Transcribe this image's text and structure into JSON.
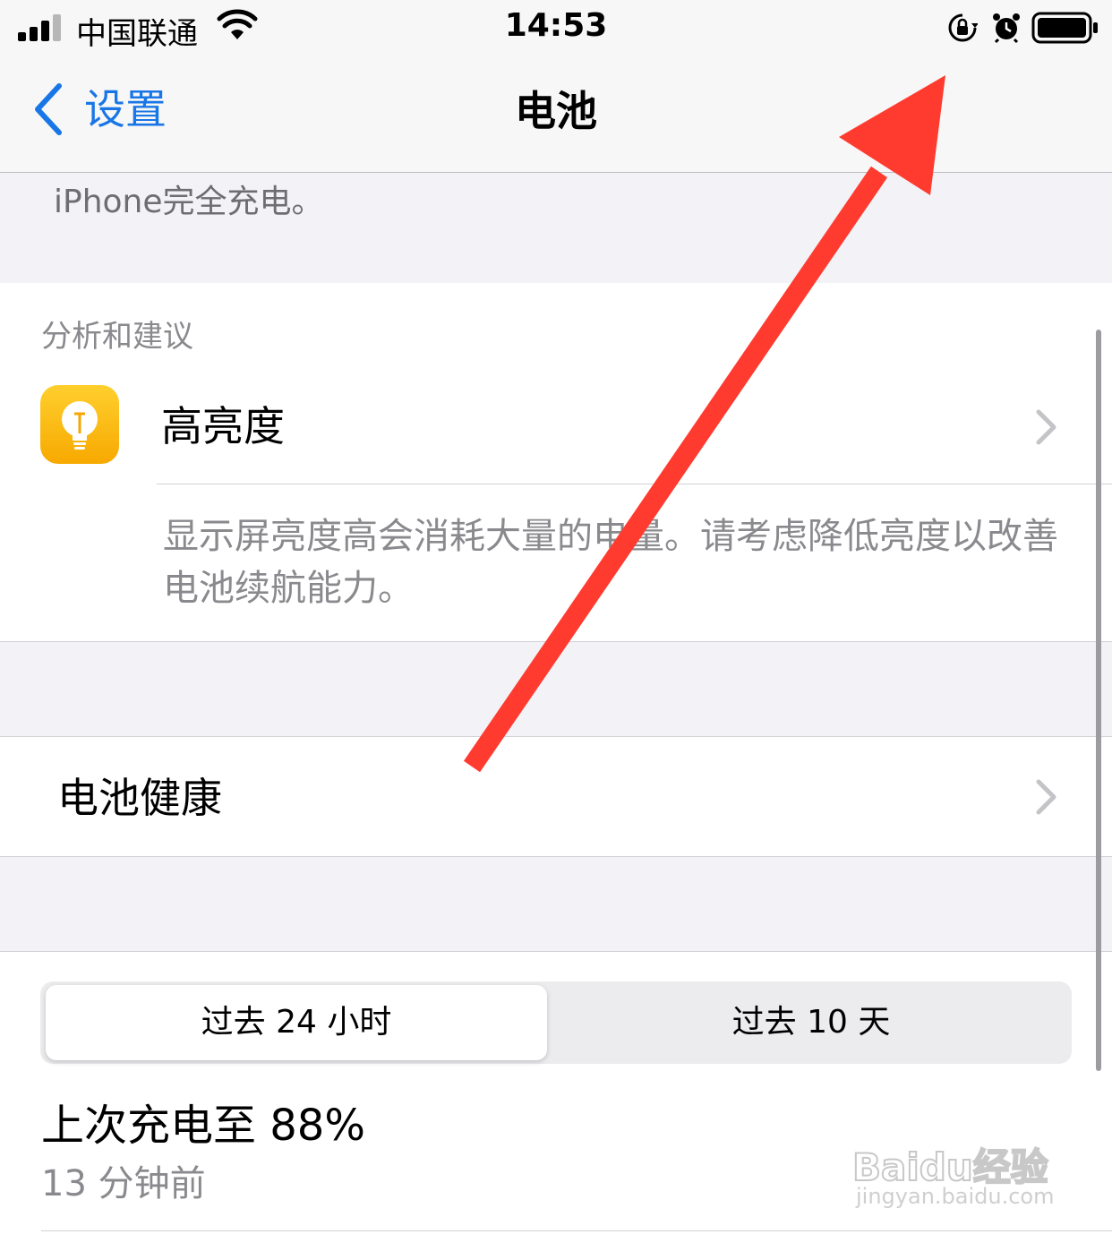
{
  "status_bar": {
    "carrier": "中国联通",
    "time": "14:53",
    "icons": [
      "signal-icon",
      "wifi-icon",
      "orientation-lock-icon",
      "alarm-icon",
      "battery-icon"
    ]
  },
  "nav": {
    "back_label": "设置",
    "title": "电池"
  },
  "footnote": "iPhone完全充电。",
  "insights": {
    "header": "分析和建议",
    "item_title": "高亮度",
    "item_description": "显示屏亮度高会消耗大量的电量。请考虑降低亮度以改善电池续航能力。",
    "icon": "lightbulb-icon",
    "icon_color": "#ffc21a"
  },
  "battery_health": {
    "label": "电池健康"
  },
  "usage": {
    "tabs": [
      "过去 24 小时",
      "过去 10 天"
    ],
    "selected_tab": 0,
    "last_charge": "上次充电至 88%",
    "last_charge_time": "13 分钟前"
  },
  "watermark": {
    "brand": "Baidu经验",
    "url": "jingyan.baidu.com"
  },
  "colors": {
    "accent": "#1976e6",
    "annotation_arrow": "#ff3b30"
  }
}
